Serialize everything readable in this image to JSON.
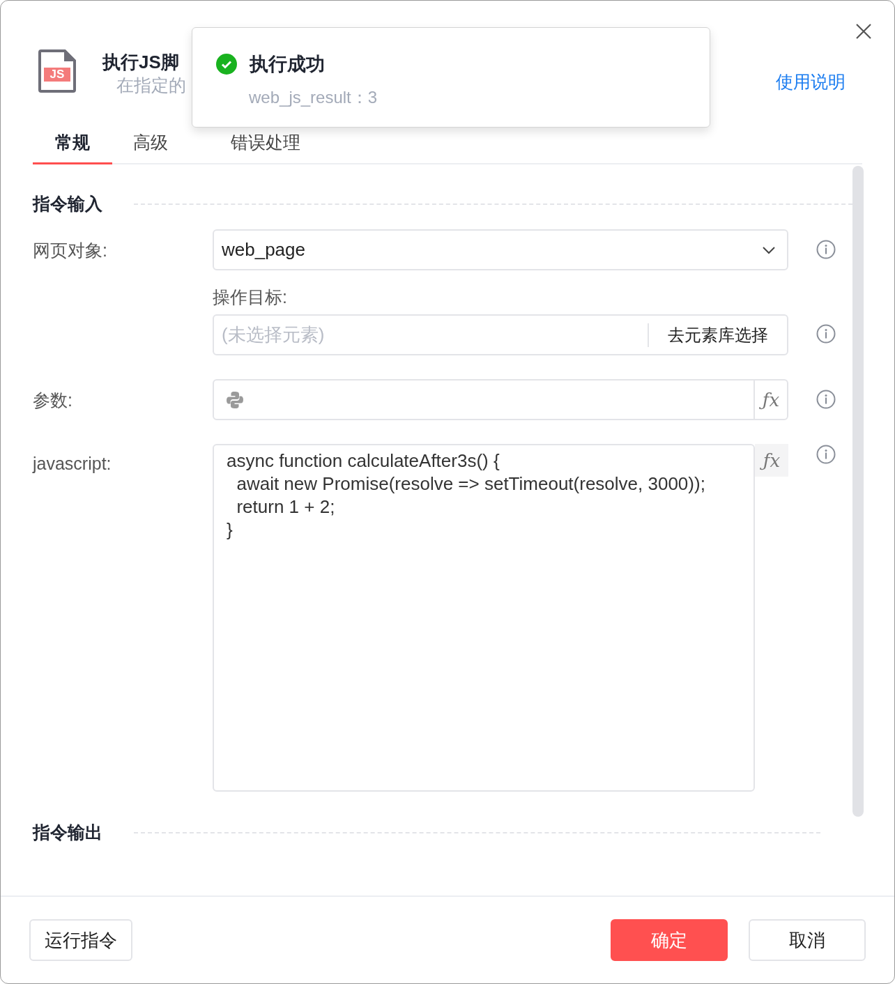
{
  "dialog": {
    "badge": "JS",
    "title": "执行JS脚",
    "subtitle": "在指定的",
    "help_link": "使用说明"
  },
  "toast": {
    "kind": "success",
    "title": "执行成功",
    "message": "web_js_result：3"
  },
  "tabs": [
    {
      "label": "常规",
      "selected": true
    },
    {
      "label": "高级",
      "selected": false
    },
    {
      "label": "错误处理",
      "selected": false
    }
  ],
  "input_section": {
    "title": "指令输入",
    "fields": [
      {
        "kind": "select",
        "label": "网页对象:",
        "value": "web_page"
      },
      {
        "kind": "element",
        "label": "操作目标:",
        "placeholder": "(未选择元素)",
        "button": "去元素库选择"
      },
      {
        "kind": "expression",
        "label": "参数:",
        "fx": "ƒx"
      },
      {
        "kind": "code",
        "label": "javascript:",
        "fx": "ƒx",
        "lines": [
          "async function calculateAfter3s() {",
          "  await new Promise(resolve => setTimeout(resolve, 3000));",
          "  return 1 + 2;",
          "}"
        ]
      }
    ]
  },
  "output_section": {
    "title": "指令输出"
  },
  "footer": {
    "buttons": [
      {
        "label": "运行指令",
        "kind": "default"
      },
      {
        "label": "确定",
        "kind": "primary"
      },
      {
        "label": "取消",
        "kind": "default"
      }
    ]
  }
}
